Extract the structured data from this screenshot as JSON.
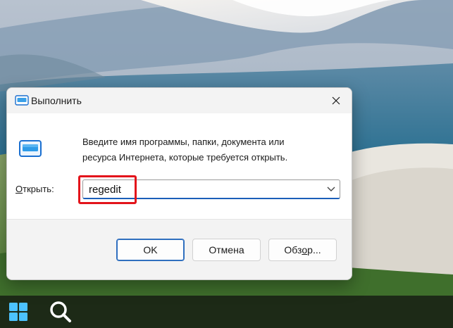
{
  "window": {
    "title": "Выполнить",
    "description_line1": "Введите имя программы, папки, документа или",
    "description_line2": "ресурса Интернета, которые требуется открыть.",
    "open_label_accel": "О",
    "open_label_rest": "ткрыть:",
    "command_value": "regedit",
    "buttons": {
      "ok": "OK",
      "cancel": "Отмена",
      "browse_pre": "Обз",
      "browse_accel": "о",
      "browse_post": "р..."
    }
  },
  "icons": {
    "title": "run-icon",
    "body": "run-icon",
    "close": "close-icon",
    "dropdown": "chevron-down-icon",
    "start": "windows-start-icon",
    "search": "search-icon"
  },
  "colors": {
    "highlight": "#e3141b",
    "accent": "#1b5fb9",
    "taskbar": "#1d2a17"
  }
}
